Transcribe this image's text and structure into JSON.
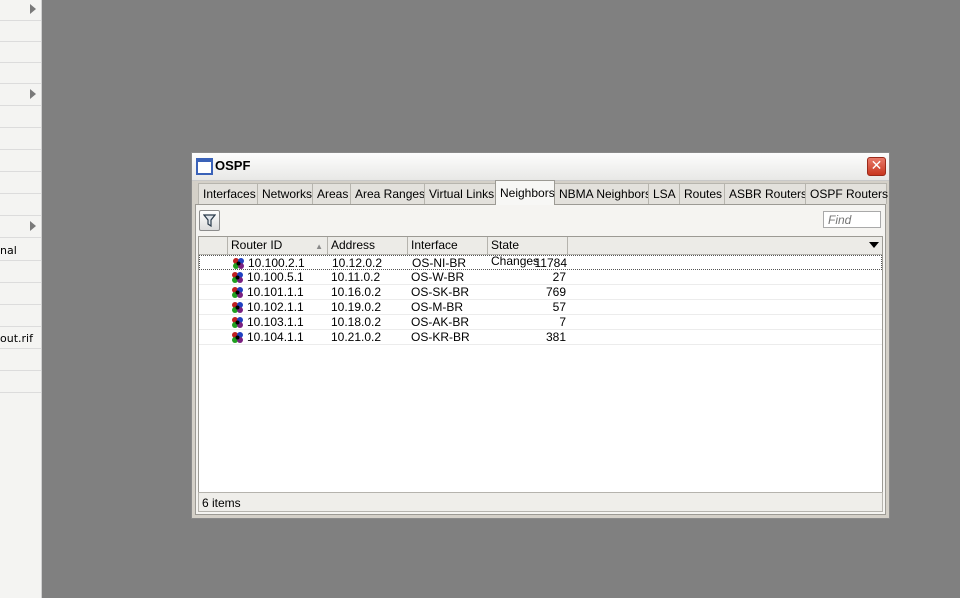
{
  "sidebar": {
    "labels": [
      "nal",
      "out.rif"
    ]
  },
  "window": {
    "title": "OSPF",
    "close_label": "✕"
  },
  "tabs": [
    {
      "label": "Interfaces"
    },
    {
      "label": "Networks"
    },
    {
      "label": "Areas"
    },
    {
      "label": "Area Ranges"
    },
    {
      "label": "Virtual Links"
    },
    {
      "label": "Neighbors",
      "active": true
    },
    {
      "label": "NBMA Neighbors"
    },
    {
      "label": "LSA"
    },
    {
      "label": "Routes"
    },
    {
      "label": "ASBR Routers"
    },
    {
      "label": "OSPF Routers"
    }
  ],
  "toolbar": {
    "find_placeholder": "Find"
  },
  "table": {
    "columns": [
      "Router ID",
      "Address",
      "Interface",
      "State Changes"
    ],
    "sort_indicator": "▲",
    "rows": [
      {
        "router_id": "10.100.2.1",
        "address": "10.12.0.2",
        "interface": "OS-NI-BR",
        "state_changes": "11784"
      },
      {
        "router_id": "10.100.5.1",
        "address": "10.11.0.2",
        "interface": "OS-W-BR",
        "state_changes": "27"
      },
      {
        "router_id": "10.101.1.1",
        "address": "10.16.0.2",
        "interface": "OS-SK-BR",
        "state_changes": "769"
      },
      {
        "router_id": "10.102.1.1",
        "address": "10.19.0.2",
        "interface": "OS-M-BR",
        "state_changes": "57"
      },
      {
        "router_id": "10.103.1.1",
        "address": "10.18.0.2",
        "interface": "OS-AK-BR",
        "state_changes": "7"
      },
      {
        "router_id": "10.104.1.1",
        "address": "10.21.0.2",
        "interface": "OS-KR-BR",
        "state_changes": "381"
      }
    ],
    "row_icon": "router-icon",
    "selected_index": 0
  },
  "status": {
    "count": "6 items"
  },
  "colors": {
    "desktop": "#808080",
    "close_button": "#c8361f",
    "window_icon": "#3a62b8"
  }
}
